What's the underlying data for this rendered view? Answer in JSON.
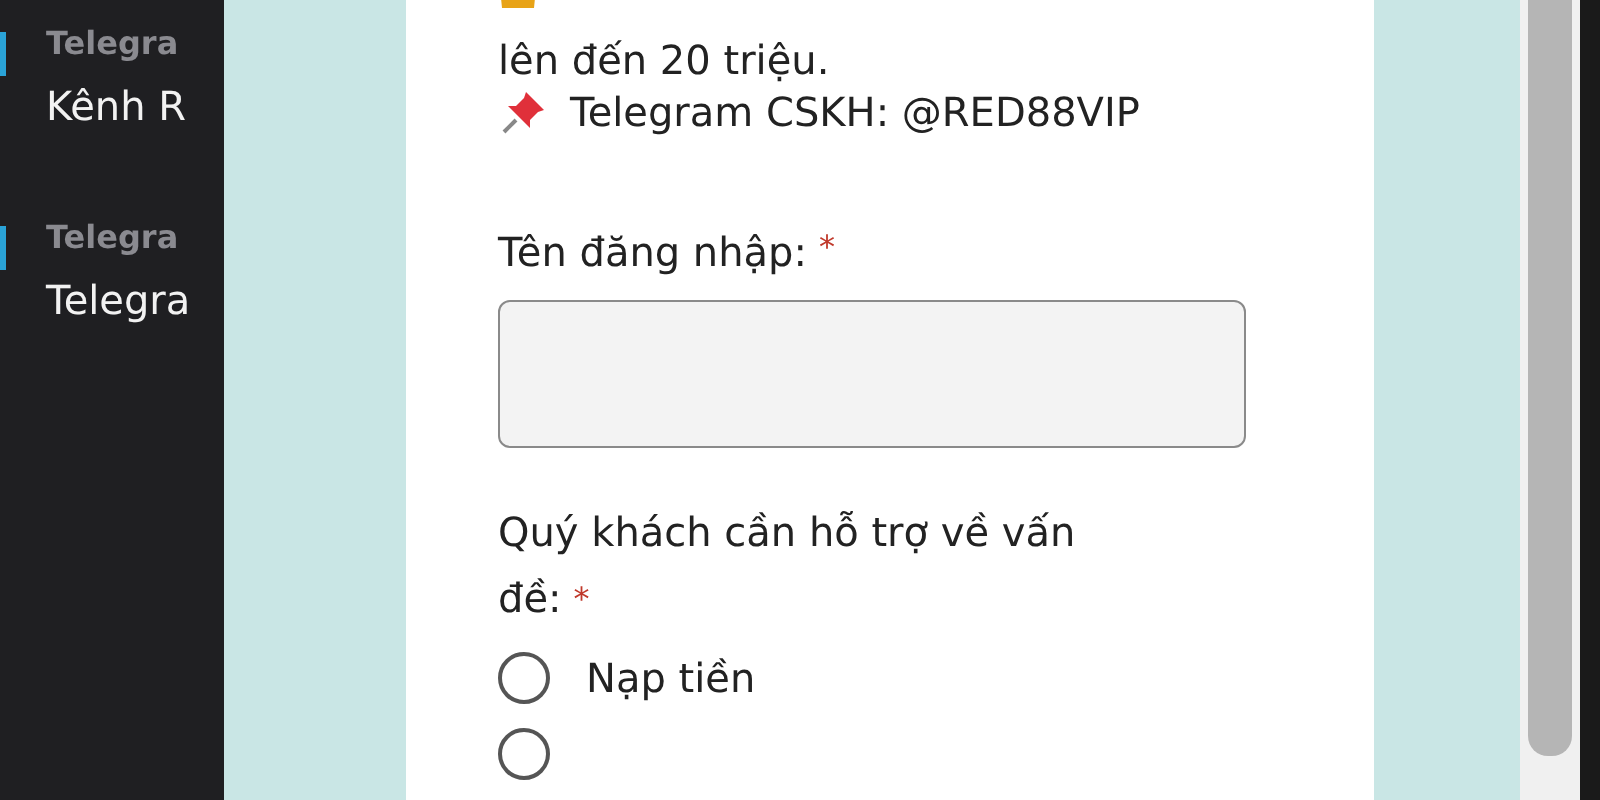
{
  "sidebar": {
    "items": [
      {
        "label": "Telegra",
        "value": "Kênh R"
      },
      {
        "label": "Telegra",
        "value": "Telegra"
      }
    ]
  },
  "form": {
    "intro": [
      {
        "kind": "crown"
      },
      {
        "kind": "plain",
        "text": "lên đến 20 triệu."
      },
      {
        "kind": "pin",
        "text": "Telegram CSKH: @RED88VIP"
      }
    ],
    "fields": [
      {
        "kind": "text",
        "label": "Tên đăng nhập:",
        "required": true,
        "required_mark": "*"
      },
      {
        "kind": "radio",
        "label_lines": [
          "Quý khách cần hỗ trợ về vấn",
          "đề:"
        ],
        "required": true,
        "required_mark": "*",
        "options": [
          {
            "label": "Nạp tiền",
            "selected": false
          },
          {
            "selected": false
          }
        ]
      }
    ]
  }
}
